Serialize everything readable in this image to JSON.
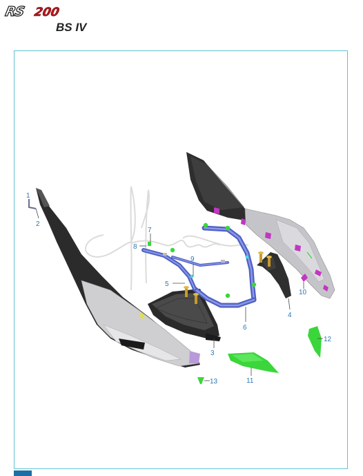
{
  "header": {
    "brand_model": "RS",
    "brand_number": "200",
    "variant": "BS IV"
  },
  "colors": {
    "frame_border": "#5fc3cf",
    "callout_text": "#2b78b5",
    "bracket_blue": "#5566c8",
    "panel_silver": "#c9c9cc",
    "panel_black": "#2a2a2a",
    "part_green": "#3bd63b",
    "bolt_gold": "#c89a2a",
    "clip_magenta": "#c236c2"
  },
  "watermark_icon": "handwritten-signature-watermark",
  "callouts": [
    {
      "id": "1",
      "label": "1"
    },
    {
      "id": "2",
      "label": "2"
    },
    {
      "id": "3",
      "label": "3"
    },
    {
      "id": "4",
      "label": "4"
    },
    {
      "id": "5",
      "label": "5"
    },
    {
      "id": "6",
      "label": "6"
    },
    {
      "id": "7",
      "label": "7"
    },
    {
      "id": "8",
      "label": "8"
    },
    {
      "id": "9",
      "label": "9"
    },
    {
      "id": "10",
      "label": "10"
    },
    {
      "id": "11",
      "label": "11"
    },
    {
      "id": "12",
      "label": "12"
    },
    {
      "id": "13",
      "label": "13"
    }
  ]
}
